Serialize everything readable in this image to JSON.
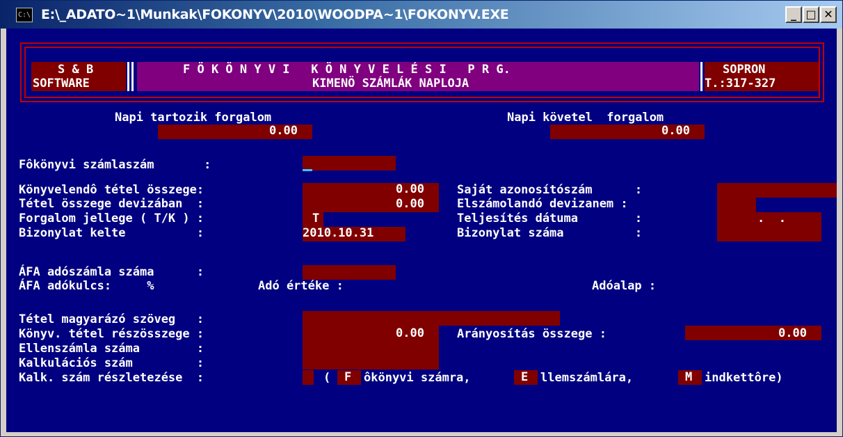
{
  "window": {
    "icon": "console-icon",
    "title": "E:\\_ADATO~1\\Munkak\\FOKONYV\\2010\\WOODPA~1\\FOKONYV.EXE",
    "buttons": {
      "minimize": "_",
      "maximize": "□",
      "close": "✕"
    }
  },
  "colors": {
    "background": "#000080",
    "field": "#800000",
    "header_center": "#800080",
    "border": "#c00000",
    "text": "#ffffff"
  },
  "header": {
    "left_line1": "S & B",
    "left_line2": "SOFTWARE",
    "center_line1": "F Ö K Ö N Y V I   K Ö N Y V E L É S I   P R G.",
    "center_line2": "KIMENÖ SZÁMLÁK NAPLOJA",
    "right_line1": "SOPRON",
    "right_line2": "T.:317-327"
  },
  "daily": {
    "debit_label": "Napi tartozik forgalom",
    "debit_value": "0.00",
    "credit_label": "Napi követel  forgalom",
    "credit_value": "0.00"
  },
  "form": {
    "account_label": "Fôkönyvi számlaszám       :",
    "amount_label": "Könyvelendô tétel összege:",
    "amount_value": "0.00",
    "fx_amount_label": "Tétel összege devizában  :",
    "fx_amount_value": "0.00",
    "type_label": "Forgalom jellege ( T/K ) :",
    "type_value": "T",
    "doc_date_label": "Bizonylat kelte          :",
    "doc_date_value": "2010.10.31",
    "own_id_label": "Saját azonosítószám      :",
    "currency_label": "Elszámolandó devizanem :",
    "perf_date_label": "Teljesítés dátuma        :",
    "perf_date_value": ".  .",
    "doc_no_label": "Bizonylat száma          :",
    "vat_invoice_label": "ÁFA adószámla száma      :",
    "vat_rate_label": "ÁFA adókulcs:     %",
    "tax_value_label": "Adó értéke :",
    "tax_base_label": "Adóalap :",
    "desc_label": "Tétel magyarázó szöveg   :",
    "partial_label": "Könyv. tétel részösszege :",
    "partial_value": "0.00",
    "prorate_label": "Arányosítás összege :",
    "prorate_value": "0.00",
    "contra_label": "Ellenszámla száma        :",
    "calc_label": "Kalkulációs szám         :",
    "calc_detail_label": "Kalk. szám részletezése  :",
    "opt_open": "(",
    "opt_f_key": "F",
    "opt_f_text": "ôkönyvi számra,",
    "opt_e_key": "E",
    "opt_e_text": "llemszámlára,",
    "opt_m_key": "M",
    "opt_m_text": "indkettôre)"
  }
}
